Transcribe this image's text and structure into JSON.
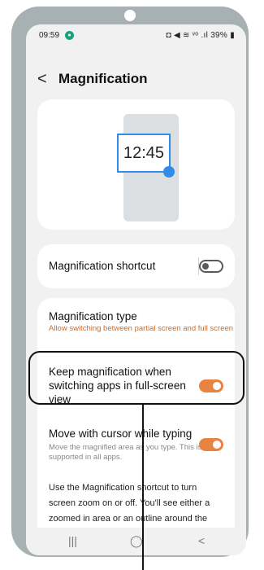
{
  "status_bar": {
    "time": "09:59",
    "right_icons": "◘ ◀ ≋ ᵛᵒ .ıl 39% ▮"
  },
  "header": {
    "back_icon": "<",
    "title": "Magnification"
  },
  "preview": {
    "clock": "12:45"
  },
  "settings": {
    "shortcut_label": "Magnification shortcut",
    "shortcut_enabled": false,
    "type_label": "Magnification type",
    "type_sub": "Allow switching between partial screen and full screen",
    "keep_label": "Keep magnification when switching apps in full-screen view",
    "keep_enabled": true,
    "cursor_label": "Move with cursor while typing",
    "cursor_sub": "Move the magnified area as you type. This isn't supported in all apps.",
    "cursor_enabled": true,
    "description": "Use the Magnification shortcut to turn screen zoom on or off. You'll see either a zoomed in area or an outline around the"
  },
  "nav": {
    "recent": "|||",
    "home": "◯",
    "back": "<"
  },
  "colors": {
    "accent": "#e98342",
    "zoom_blue": "#2f8ce8",
    "frame": "#a7b0b2"
  }
}
